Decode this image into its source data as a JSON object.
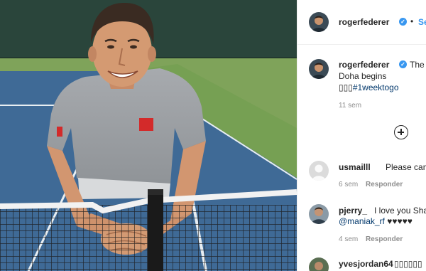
{
  "post": {
    "author": "rogerfederer",
    "follow_label": "Seguir",
    "separator": "•"
  },
  "caption": {
    "author": "rogerfederer",
    "line1": "The co",
    "line2": "Doha begins",
    "line3_prefix": "▯▯▯",
    "hashtag": "#1weektogo",
    "time": "11 sem"
  },
  "load_more_icon": "plus-circle-icon",
  "comments": [
    {
      "user": "usmailll",
      "text": "Please can you",
      "time": "6 sem",
      "reply": "Responder"
    },
    {
      "user": "pjerry_",
      "text": "I love you Shag",
      "mention": "@maniak_rf",
      "hearts": "♥♥♥♥♥",
      "time": "4 sem",
      "reply": "Responder"
    },
    {
      "user": "yvesjordan64",
      "text": "▯▯▯▯▯▯"
    }
  ],
  "colors": {
    "accent": "#3897f0",
    "text": "#262626",
    "muted": "#8e8e8e",
    "court_blue": "#3f6a96",
    "court_green": "#7fa35a"
  }
}
